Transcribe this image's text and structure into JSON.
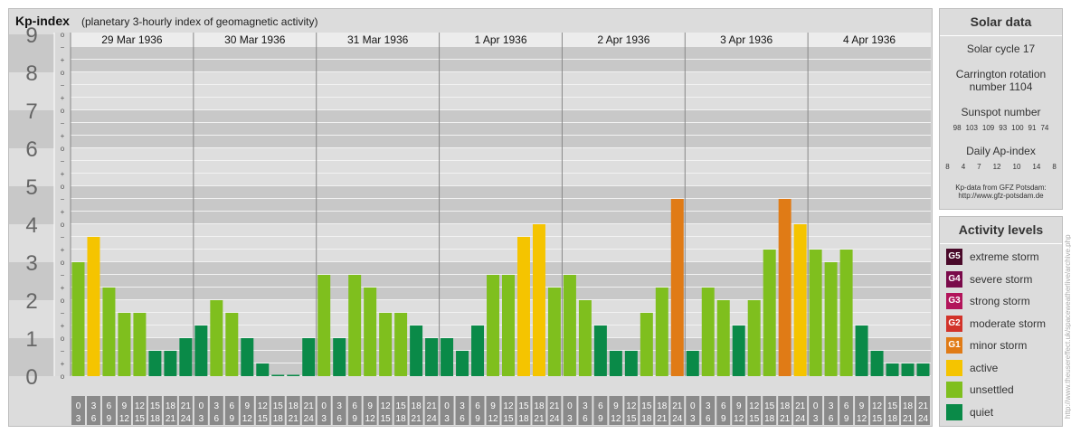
{
  "title": "Kp-index",
  "subtitle": "(planetary 3-hourly index of geomagnetic activity)",
  "colors": {
    "quiet": "#0a8a48",
    "unsettled": "#7fbf1e",
    "active": "#f5c400",
    "minor_storm": "#e07b16"
  },
  "chart_data": {
    "type": "bar",
    "ylim": [
      0,
      9
    ],
    "y_ticks": [
      "0",
      "1",
      "2",
      "3",
      "4",
      "5",
      "6",
      "7",
      "8",
      "9"
    ],
    "minor_tick_labels": [
      "o",
      "+",
      "−"
    ],
    "days": [
      "29 Mar 1936",
      "30 Mar 1936",
      "31 Mar 1936",
      "1 Apr 1936",
      "2 Apr 1936",
      "3 Apr 1936",
      "4 Apr 1936"
    ],
    "x_tick_labels": [
      [
        "0",
        "3"
      ],
      [
        "3",
        "6"
      ],
      [
        "6",
        "9"
      ],
      [
        "9",
        "12"
      ],
      [
        "12",
        "15"
      ],
      [
        "15",
        "18"
      ],
      [
        "18",
        "21"
      ],
      [
        "21",
        "24"
      ]
    ],
    "values": [
      [
        3.0,
        3.667,
        2.333,
        1.667,
        1.667,
        0.667,
        0.667,
        1.0
      ],
      [
        1.333,
        2.0,
        1.667,
        1.0,
        0.333,
        0.0,
        0.0,
        1.0
      ],
      [
        2.667,
        1.0,
        2.667,
        2.333,
        1.667,
        1.667,
        1.333,
        1.0
      ],
      [
        1.0,
        0.667,
        1.333,
        2.667,
        2.667,
        3.667,
        4.0,
        2.333
      ],
      [
        2.667,
        2.0,
        1.333,
        0.667,
        0.667,
        1.667,
        2.333,
        4.667
      ],
      [
        0.667,
        2.333,
        2.0,
        1.333,
        2.0,
        3.333,
        4.667,
        4.0
      ],
      [
        3.333,
        3.0,
        3.333,
        1.333,
        0.667,
        0.333,
        0.333,
        0.333
      ]
    ]
  },
  "solar": {
    "title": "Solar data",
    "cycle": "Solar cycle 17",
    "carrington_line1": "Carrington rotation",
    "carrington_line2": "number 1104",
    "sunspot_title": "Sunspot number",
    "sunspot_values": [
      "98",
      "103",
      "109",
      "93",
      "100",
      "91",
      "74"
    ],
    "ap_title": "Daily Ap-index",
    "ap_values": [
      "8",
      "4",
      "7",
      "12",
      "10",
      "14",
      "8"
    ],
    "source_line1": "Kp-data from GFZ Potsdam:",
    "source_line2": "http://www.gfz-potsdam.de"
  },
  "activity": {
    "title": "Activity levels",
    "items": [
      {
        "badge": "G5",
        "label": "extreme storm",
        "color": "#4a0a2a"
      },
      {
        "badge": "G4",
        "label": "severe storm",
        "color": "#7a0a4a"
      },
      {
        "badge": "G3",
        "label": "strong storm",
        "color": "#b2145a"
      },
      {
        "badge": "G2",
        "label": "moderate storm",
        "color": "#d2332a"
      },
      {
        "badge": "G1",
        "label": "minor storm",
        "color": "#e07b16"
      },
      {
        "badge": "",
        "label": "active",
        "color": "#f5c400"
      },
      {
        "badge": "",
        "label": "unsettled",
        "color": "#7fbf1e"
      },
      {
        "badge": "",
        "label": "quiet",
        "color": "#0a8a48"
      }
    ]
  },
  "credit": "http://www.theusereffect.uk/spaceweatherlive/archive.php"
}
